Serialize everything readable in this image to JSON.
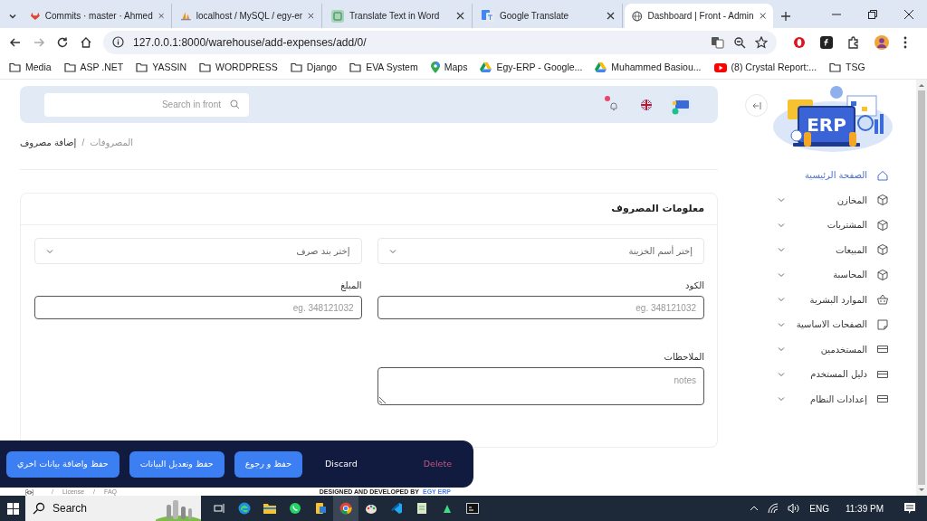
{
  "browser": {
    "tabs": [
      {
        "title": "Dashboard | Front - Admin",
        "selected": true
      },
      {
        "title": "Google Translate",
        "selected": false
      },
      {
        "title": "Translate Text in Word",
        "selected": false
      },
      {
        "title": "localhost / MySQL / egy-er",
        "selected": false
      },
      {
        "title": "Commits · master · Ahmed",
        "selected": false
      }
    ],
    "url": "127.0.0.1:8000/warehouse/add-expenses/add/0/",
    "bookmarks": [
      {
        "label": "TSG",
        "kind": "folder"
      },
      {
        "label": "(8) Crystal Report:...",
        "kind": "video"
      },
      {
        "label": "Muhammed Basiou...",
        "kind": "drive"
      },
      {
        "label": "Egy-ERP - Google...",
        "kind": "drive"
      },
      {
        "label": "Maps",
        "kind": "maps"
      },
      {
        "label": "EVA System",
        "kind": "folder"
      },
      {
        "label": "Django",
        "kind": "folder"
      },
      {
        "label": "WORDPRESS",
        "kind": "folder"
      },
      {
        "label": "YASSIN",
        "kind": "folder"
      },
      {
        "label": "ASP .NET",
        "kind": "folder"
      },
      {
        "label": "Media",
        "kind": "folder"
      }
    ]
  },
  "header": {
    "search_placeholder": "Search in front"
  },
  "breadcrumb": {
    "items": [
      "المصروفات",
      "إضافة مصروف"
    ],
    "separator": "/"
  },
  "form": {
    "title": "معلومات المصروف",
    "fields": [
      {
        "kind": "select",
        "placeholder": "إختر أسم الخزينة"
      },
      {
        "kind": "select",
        "placeholder": "إختر بند صرف"
      },
      {
        "kind": "input",
        "label": "الكود",
        "placeholder": "eg. 348121032"
      },
      {
        "kind": "input",
        "label": "المبلغ",
        "placeholder": "eg. 348121032"
      },
      {
        "kind": "textarea",
        "label": "الملاحظات",
        "placeholder": "notes"
      }
    ]
  },
  "actions": [
    {
      "label": "Delete",
      "kind": "danger"
    },
    {
      "label": "Discard",
      "kind": "plain"
    },
    {
      "label": "حفظ و رجوع",
      "kind": "primary"
    },
    {
      "label": "حفظ وتعديل البيانات",
      "kind": "primary"
    },
    {
      "label": "حفظ واضافة بيانات اخري",
      "kind": "primary"
    }
  ],
  "footer": {
    "links": [
      "FAQ",
      "License"
    ],
    "separator": "/",
    "credit": "DESIGNED AND DEVELOPED BY",
    "brand": "EGY ERP"
  },
  "sidebar": {
    "logo_text": "ERP",
    "items": [
      {
        "label": "الصفحة الرئيسية",
        "selected": true,
        "expandable": false
      },
      {
        "label": "المخازن",
        "selected": false,
        "expandable": true
      },
      {
        "label": "المشتريات",
        "selected": false,
        "expandable": true
      },
      {
        "label": "المبيعات",
        "selected": false,
        "expandable": true
      },
      {
        "label": "المحاسبة",
        "selected": false,
        "expandable": true
      },
      {
        "label": "الموارد البشرية",
        "selected": false,
        "expandable": true
      },
      {
        "label": "الصفحات الاساسية",
        "selected": false,
        "expandable": true
      },
      {
        "label": "المستخدمين",
        "selected": false,
        "expandable": true
      },
      {
        "label": "دليل المستخدم",
        "selected": false,
        "expandable": true
      },
      {
        "label": "إعدادات النظام",
        "selected": false,
        "expandable": true
      }
    ]
  },
  "taskbar": {
    "search": "Search",
    "language": "ENG",
    "time": "11:39 PM"
  }
}
